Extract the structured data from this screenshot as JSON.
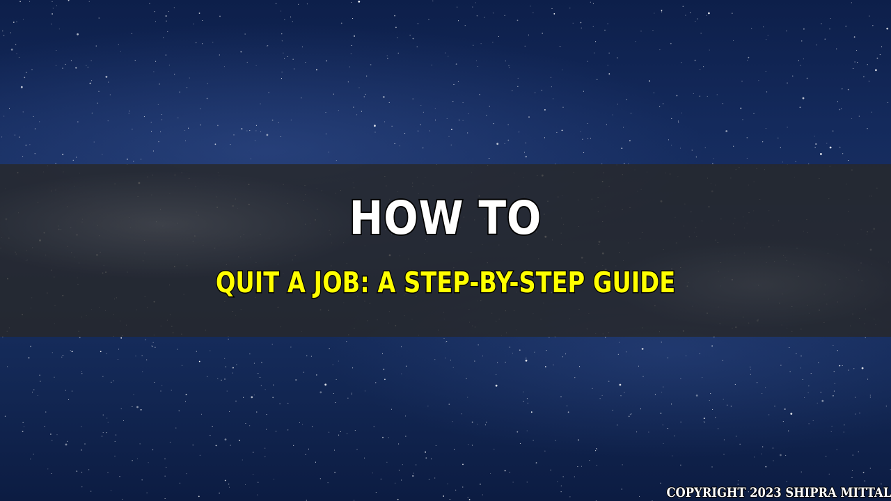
{
  "title": "HOW TO",
  "subtitle": "QUIT A JOB: A STEP-BY-STEP GUIDE",
  "copyright": "COPYRIGHT 2023 SHIPRA MITTAL",
  "colors": {
    "title": "#ffffff",
    "subtitle": "#ffff00",
    "band": "#282828",
    "sky": "#1a3266"
  }
}
